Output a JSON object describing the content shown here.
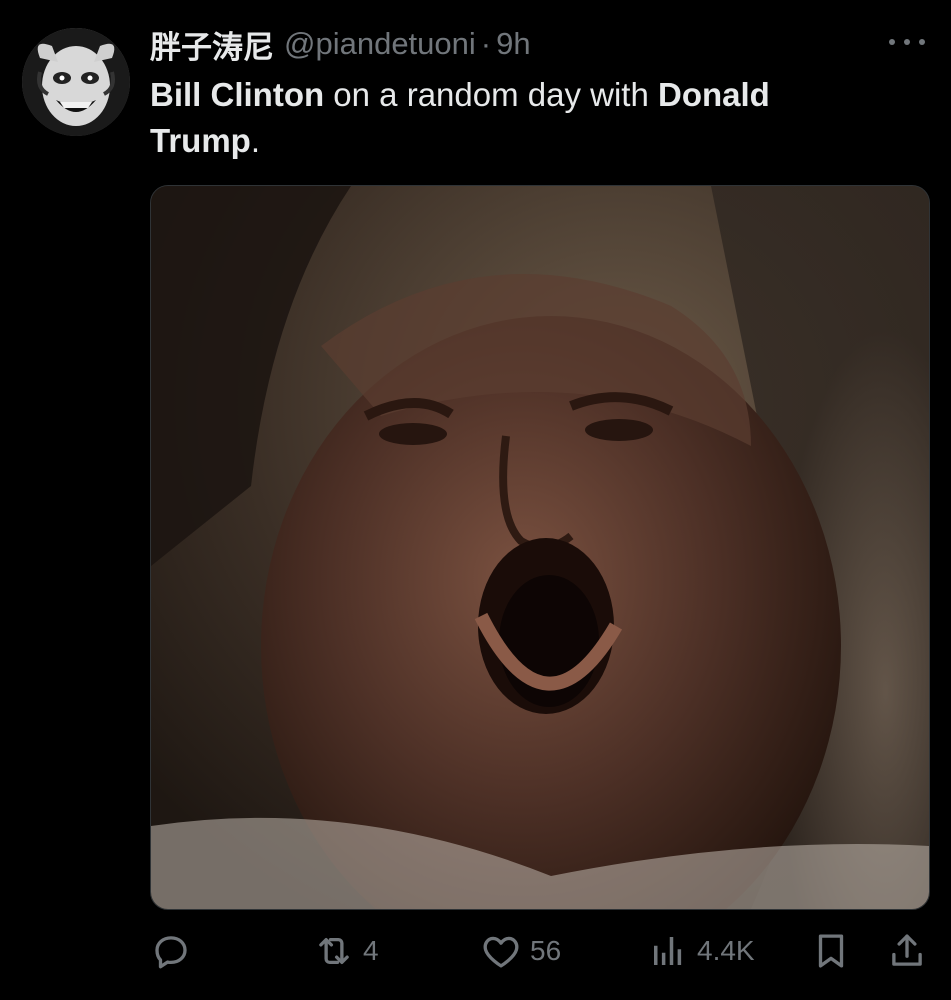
{
  "author": {
    "display_name": "胖子涛尼",
    "handle": "@piandetuoni",
    "separator": "·",
    "time": "9h"
  },
  "tweet": {
    "text_parts": [
      {
        "text": "Bill Clinton",
        "bold": true
      },
      {
        "text": " on a random day with ",
        "bold": false
      },
      {
        "text": "Donald Trump",
        "bold": true
      },
      {
        "text": ".",
        "bold": false
      }
    ]
  },
  "media": {
    "alt": "photo"
  },
  "actions": {
    "reply": {
      "icon": "reply-icon",
      "count": ""
    },
    "retweet": {
      "icon": "retweet-icon",
      "count": "4"
    },
    "like": {
      "icon": "heart-icon",
      "count": "56"
    },
    "views": {
      "icon": "views-icon",
      "count": "4.4K"
    },
    "bookmark": {
      "icon": "bookmark-icon"
    },
    "share": {
      "icon": "share-icon"
    }
  },
  "colors": {
    "background": "#000000",
    "primary_text": "#e7e9ea",
    "secondary_text": "#71767b"
  }
}
